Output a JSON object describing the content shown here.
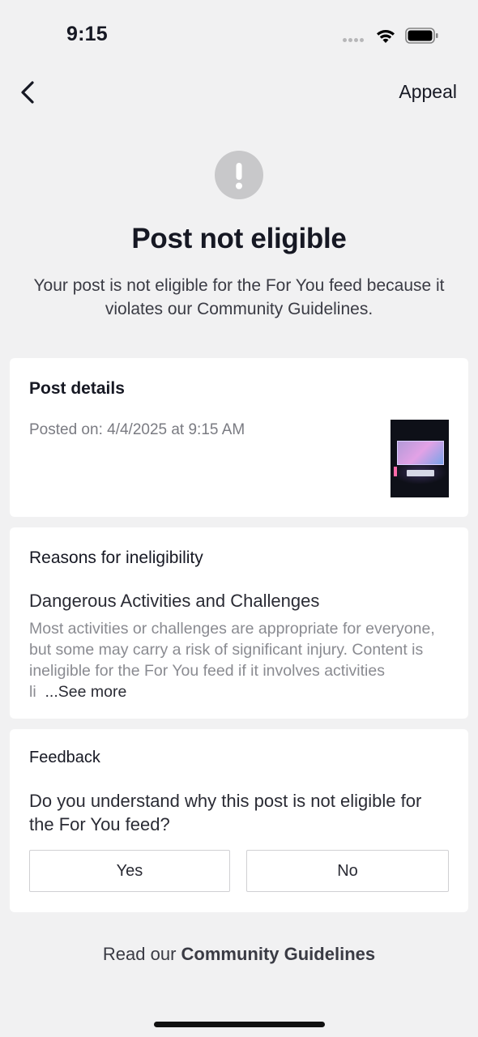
{
  "status_bar": {
    "time": "9:15"
  },
  "header": {
    "appeal_label": "Appeal"
  },
  "hero": {
    "title": "Post not eligible",
    "subtitle": "Your post is not eligible for the For You feed because it violates our Community Guidelines."
  },
  "post_details": {
    "heading": "Post details",
    "posted_on": "Posted on: 4/4/2025 at 9:15 AM"
  },
  "reasons": {
    "heading": "Reasons for ineligibility",
    "reason_title": "Dangerous Activities and Challenges",
    "reason_body": "Most activities or challenges are appropriate for everyone, but some may carry a risk of significant injury. Content is ineligible for the For You feed if it involves activities li",
    "see_more_label": "...See more"
  },
  "feedback": {
    "heading": "Feedback",
    "question": "Do you understand why this post is not eligible for the For You feed?",
    "yes_label": "Yes",
    "no_label": "No"
  },
  "footer": {
    "prefix": "Read our ",
    "link_label": "Community Guidelines"
  },
  "icons": {
    "back": "chevron-left-icon",
    "alert": "exclamation-circle-icon",
    "wifi": "wifi-icon",
    "battery": "battery-icon",
    "signal": "signal-dots-icon"
  },
  "colors": {
    "background": "#f1f1f2",
    "card": "#ffffff",
    "alert_icon": "#c8c8ca",
    "primary_text": "#161823",
    "secondary_text": "#8a8b91"
  }
}
